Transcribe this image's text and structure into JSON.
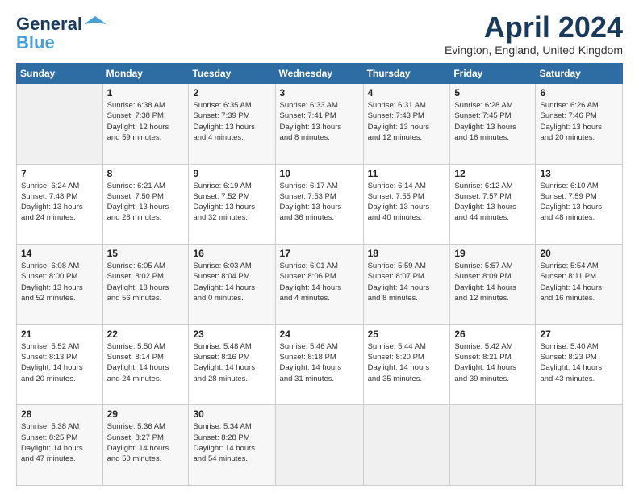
{
  "logo": {
    "line1": "General",
    "line2": "Blue",
    "tagline": "▲"
  },
  "header": {
    "month_year": "April 2024",
    "location": "Evington, England, United Kingdom"
  },
  "weekdays": [
    "Sunday",
    "Monday",
    "Tuesday",
    "Wednesday",
    "Thursday",
    "Friday",
    "Saturday"
  ],
  "weeks": [
    [
      {
        "day": "",
        "info": ""
      },
      {
        "day": "1",
        "info": "Sunrise: 6:38 AM\nSunset: 7:38 PM\nDaylight: 12 hours\nand 59 minutes."
      },
      {
        "day": "2",
        "info": "Sunrise: 6:35 AM\nSunset: 7:39 PM\nDaylight: 13 hours\nand 4 minutes."
      },
      {
        "day": "3",
        "info": "Sunrise: 6:33 AM\nSunset: 7:41 PM\nDaylight: 13 hours\nand 8 minutes."
      },
      {
        "day": "4",
        "info": "Sunrise: 6:31 AM\nSunset: 7:43 PM\nDaylight: 13 hours\nand 12 minutes."
      },
      {
        "day": "5",
        "info": "Sunrise: 6:28 AM\nSunset: 7:45 PM\nDaylight: 13 hours\nand 16 minutes."
      },
      {
        "day": "6",
        "info": "Sunrise: 6:26 AM\nSunset: 7:46 PM\nDaylight: 13 hours\nand 20 minutes."
      }
    ],
    [
      {
        "day": "7",
        "info": "Sunrise: 6:24 AM\nSunset: 7:48 PM\nDaylight: 13 hours\nand 24 minutes."
      },
      {
        "day": "8",
        "info": "Sunrise: 6:21 AM\nSunset: 7:50 PM\nDaylight: 13 hours\nand 28 minutes."
      },
      {
        "day": "9",
        "info": "Sunrise: 6:19 AM\nSunset: 7:52 PM\nDaylight: 13 hours\nand 32 minutes."
      },
      {
        "day": "10",
        "info": "Sunrise: 6:17 AM\nSunset: 7:53 PM\nDaylight: 13 hours\nand 36 minutes."
      },
      {
        "day": "11",
        "info": "Sunrise: 6:14 AM\nSunset: 7:55 PM\nDaylight: 13 hours\nand 40 minutes."
      },
      {
        "day": "12",
        "info": "Sunrise: 6:12 AM\nSunset: 7:57 PM\nDaylight: 13 hours\nand 44 minutes."
      },
      {
        "day": "13",
        "info": "Sunrise: 6:10 AM\nSunset: 7:59 PM\nDaylight: 13 hours\nand 48 minutes."
      }
    ],
    [
      {
        "day": "14",
        "info": "Sunrise: 6:08 AM\nSunset: 8:00 PM\nDaylight: 13 hours\nand 52 minutes."
      },
      {
        "day": "15",
        "info": "Sunrise: 6:05 AM\nSunset: 8:02 PM\nDaylight: 13 hours\nand 56 minutes."
      },
      {
        "day": "16",
        "info": "Sunrise: 6:03 AM\nSunset: 8:04 PM\nDaylight: 14 hours\nand 0 minutes."
      },
      {
        "day": "17",
        "info": "Sunrise: 6:01 AM\nSunset: 8:06 PM\nDaylight: 14 hours\nand 4 minutes."
      },
      {
        "day": "18",
        "info": "Sunrise: 5:59 AM\nSunset: 8:07 PM\nDaylight: 14 hours\nand 8 minutes."
      },
      {
        "day": "19",
        "info": "Sunrise: 5:57 AM\nSunset: 8:09 PM\nDaylight: 14 hours\nand 12 minutes."
      },
      {
        "day": "20",
        "info": "Sunrise: 5:54 AM\nSunset: 8:11 PM\nDaylight: 14 hours\nand 16 minutes."
      }
    ],
    [
      {
        "day": "21",
        "info": "Sunrise: 5:52 AM\nSunset: 8:13 PM\nDaylight: 14 hours\nand 20 minutes."
      },
      {
        "day": "22",
        "info": "Sunrise: 5:50 AM\nSunset: 8:14 PM\nDaylight: 14 hours\nand 24 minutes."
      },
      {
        "day": "23",
        "info": "Sunrise: 5:48 AM\nSunset: 8:16 PM\nDaylight: 14 hours\nand 28 minutes."
      },
      {
        "day": "24",
        "info": "Sunrise: 5:46 AM\nSunset: 8:18 PM\nDaylight: 14 hours\nand 31 minutes."
      },
      {
        "day": "25",
        "info": "Sunrise: 5:44 AM\nSunset: 8:20 PM\nDaylight: 14 hours\nand 35 minutes."
      },
      {
        "day": "26",
        "info": "Sunrise: 5:42 AM\nSunset: 8:21 PM\nDaylight: 14 hours\nand 39 minutes."
      },
      {
        "day": "27",
        "info": "Sunrise: 5:40 AM\nSunset: 8:23 PM\nDaylight: 14 hours\nand 43 minutes."
      }
    ],
    [
      {
        "day": "28",
        "info": "Sunrise: 5:38 AM\nSunset: 8:25 PM\nDaylight: 14 hours\nand 47 minutes."
      },
      {
        "day": "29",
        "info": "Sunrise: 5:36 AM\nSunset: 8:27 PM\nDaylight: 14 hours\nand 50 minutes."
      },
      {
        "day": "30",
        "info": "Sunrise: 5:34 AM\nSunset: 8:28 PM\nDaylight: 14 hours\nand 54 minutes."
      },
      {
        "day": "",
        "info": ""
      },
      {
        "day": "",
        "info": ""
      },
      {
        "day": "",
        "info": ""
      },
      {
        "day": "",
        "info": ""
      }
    ]
  ]
}
